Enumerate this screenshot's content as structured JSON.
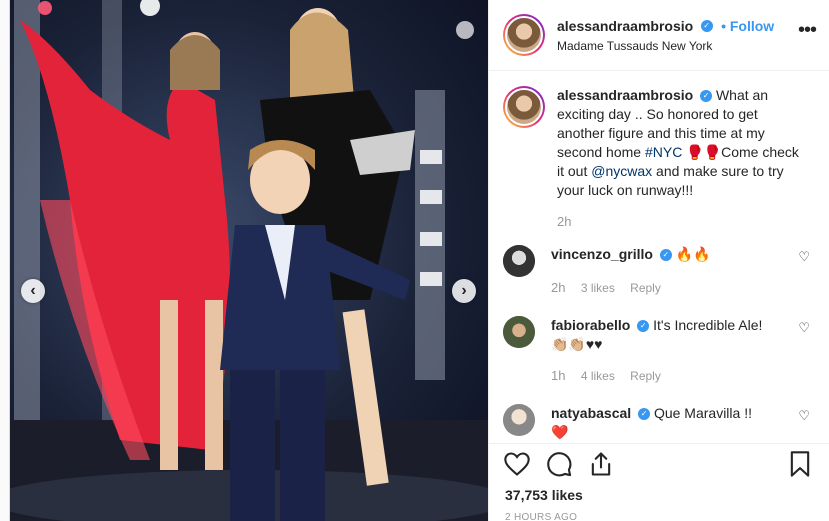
{
  "post": {
    "username": "alessandraambrosio",
    "follow_label": "Follow",
    "location": "Madame Tussauds New York",
    "more_icon": "more-options-icon",
    "verified_mark": "✓"
  },
  "caption": {
    "username": "alessandraambrosio",
    "text_1": "What an exciting day .. So honored to get another figure and this time at my second home ",
    "hashtag": "#NYC",
    "emoji": "🥊🥊",
    "text_2": "Come check it out ",
    "mention": "@nycwax",
    "text_3": " and make sure to try your luck on runway!!!",
    "time": "2h"
  },
  "comments": [
    {
      "username": "vincenzo_grillo",
      "text": "🔥🔥",
      "time": "2h",
      "likes": "3 likes",
      "reply": "Reply"
    },
    {
      "username": "fabiorabello",
      "text": "It's Incredible Ale!",
      "text_line2": "👏🏼👏🏼♥♥",
      "time": "1h",
      "likes": "4 likes",
      "reply": "Reply"
    },
    {
      "username": "natyabascal",
      "text": "Que Maravilla !!",
      "text_line2": "❤️"
    }
  ],
  "actions": {
    "likes": "37,753 likes",
    "posted": "2 HOURS AGO"
  },
  "colors": {
    "accent": "#3897f0",
    "verified": "#3897f0",
    "link": "#003569"
  }
}
